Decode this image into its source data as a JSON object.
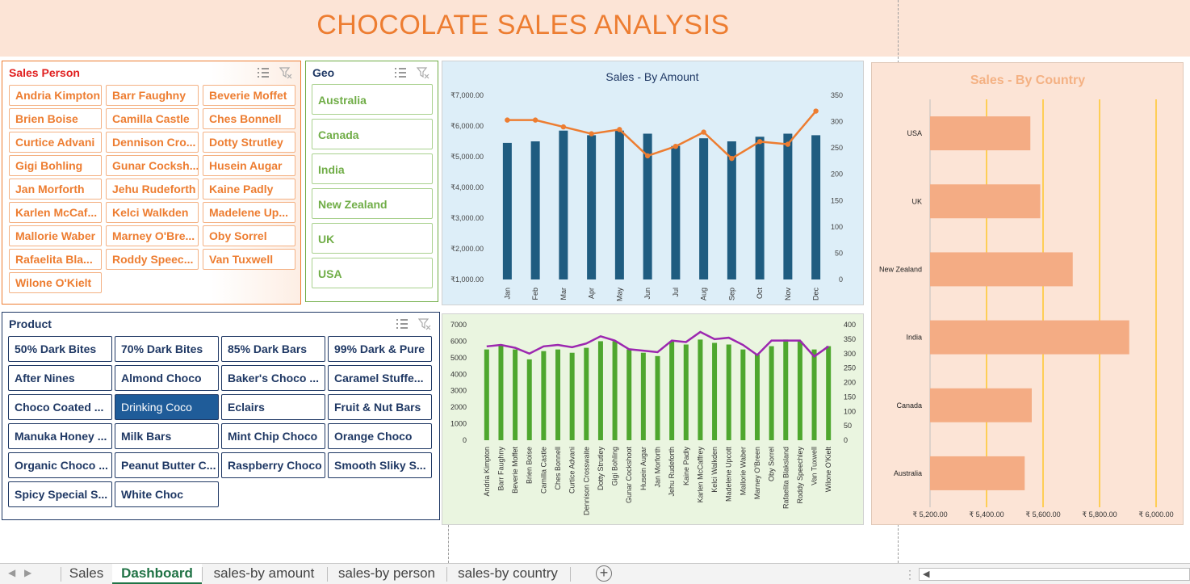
{
  "title": "CHOCOLATE SALES ANALYSIS",
  "colors": {
    "title": "#ed7d31",
    "title_bg": "#fce4d6",
    "sales_person": "#ed7d31",
    "geo": "#70ad47",
    "product": "#1f3864",
    "selected": "#1f5c99"
  },
  "sales_person_slicer": {
    "title": "Sales Person",
    "items": [
      "Andria Kimpton",
      "Barr Faughny",
      "Beverie Moffet",
      "Brien Boise",
      "Camilla Castle",
      "Ches Bonnell",
      "Curtice Advani",
      "Dennison Cro...",
      "Dotty Strutley",
      "Gigi Bohling",
      "Gunar Cocksh...",
      "Husein Augar",
      "Jan Morforth",
      "Jehu Rudeforth",
      "Kaine Padly",
      "Karlen McCaf...",
      "Kelci Walkden",
      "Madelene Up...",
      "Mallorie Waber",
      "Marney O'Bre...",
      "Oby Sorrel",
      "Rafaelita Bla...",
      "Roddy Speec...",
      "Van Tuxwell",
      "Wilone O'Kielt"
    ]
  },
  "geo_slicer": {
    "title": "Geo",
    "items": [
      "Australia",
      "Canada",
      "India",
      "New Zealand",
      "UK",
      "USA"
    ]
  },
  "product_slicer": {
    "title": "Product",
    "selected": "Drinking Coco",
    "items": [
      "50% Dark Bites",
      "70% Dark Bites",
      "85% Dark Bars",
      "99% Dark & Pure",
      "After Nines",
      "Almond Choco",
      "Baker's Choco ...",
      "Caramel Stuffe...",
      "Choco Coated ...",
      "Drinking Coco",
      "Eclairs",
      "Fruit & Nut Bars",
      "Manuka Honey ...",
      "Milk Bars",
      "Mint Chip Choco",
      "Orange Choco",
      "Organic Choco ...",
      "Peanut Butter C...",
      "Raspberry Choco",
      "Smooth Sliky S...",
      "Spicy Special S...",
      "White Choc"
    ]
  },
  "icons": {
    "multi_select": "multi-select-icon",
    "clear_filter": "clear-filter-icon"
  },
  "chart_data": [
    {
      "type": "bar",
      "title": "Sales - By Amount",
      "categories": [
        "Jan",
        "Feb",
        "Mar",
        "Apr",
        "May",
        "Jun",
        "Jul",
        "Aug",
        "Sep",
        "Oct",
        "Nov",
        "Dec"
      ],
      "bar_values": [
        5450,
        5500,
        5850,
        5700,
        5850,
        5750,
        5350,
        5600,
        5500,
        5650,
        5750,
        5700
      ],
      "line_values": [
        303,
        303,
        290,
        277,
        285,
        235,
        253,
        280,
        230,
        262,
        257,
        320
      ],
      "yticks_left": [
        "₹7,000.00",
        "₹6,000.00",
        "₹5,000.00",
        "₹4,000.00",
        "₹3,000.00",
        "₹2,000.00",
        "₹1,000.00"
      ],
      "yticks_right": [
        "350",
        "300",
        "250",
        "200",
        "150",
        "100",
        "50",
        "0"
      ],
      "ylim_left": [
        1000,
        7000
      ],
      "ylim_right": [
        0,
        350
      ],
      "bar_color": "#1f5c80",
      "line_color": "#ed7d31"
    },
    {
      "type": "bar",
      "categories": [
        "Andria Kimpton",
        "Barr Faughny",
        "Beverie Moffet",
        "Brien Boise",
        "Camilla Castle",
        "Ches Bonnell",
        "Curtice Advani",
        "Dennison Crosswaite",
        "Dotty Strutley",
        "Gigi Bohling",
        "Gunar Cockshoot",
        "Husein Augar",
        "Jan Morforth",
        "Jehu Rudeforth",
        "Kaine Padly",
        "Karlen McCaffrey",
        "Kelci Walkden",
        "Madelene Upcott",
        "Mallorie Waber",
        "Marney O'Breen",
        "Oby Sorrel",
        "Rafaelita Blaksland",
        "Roddy Speechley",
        "Van Tuxwell",
        "Wilone O'Kielt"
      ],
      "bar_values": [
        5500,
        5800,
        5500,
        4900,
        5400,
        5500,
        5300,
        5600,
        6000,
        6000,
        5500,
        5300,
        5100,
        6000,
        5800,
        6100,
        5900,
        5800,
        5500,
        5200,
        5700,
        6100,
        6000,
        5500,
        5700
      ],
      "line_values": [
        325,
        330,
        320,
        300,
        325,
        330,
        322,
        335,
        360,
        345,
        315,
        310,
        305,
        345,
        340,
        375,
        350,
        355,
        330,
        295,
        345,
        345,
        345,
        290,
        325
      ],
      "yticks_left": [
        "7000",
        "6000",
        "5000",
        "4000",
        "3000",
        "2000",
        "1000",
        "0"
      ],
      "yticks_right": [
        "400",
        "350",
        "300",
        "250",
        "200",
        "150",
        "100",
        "50",
        "0"
      ],
      "ylim_left": [
        0,
        7000
      ],
      "ylim_right": [
        0,
        400
      ],
      "bar_color": "#4ea72e",
      "line_color": "#9c27b0"
    },
    {
      "type": "bar",
      "title": "Sales - By Country",
      "categories": [
        "USA",
        "UK",
        "New Zealand",
        "India",
        "Canada",
        "Australia"
      ],
      "values": [
        5555,
        5590,
        5705,
        5905,
        5560,
        5535
      ],
      "xticks": [
        "₹ 5,200.00",
        "₹ 5,400.00",
        "₹ 5,600.00",
        "₹ 5,800.00",
        "₹ 6,000.00"
      ],
      "xlim": [
        5200,
        6000
      ],
      "bar_color": "#f4ac84"
    }
  ],
  "tabs": {
    "sales": "Sales",
    "dashboard": "Dashboard",
    "by_amount": "sales-by amount",
    "by_person": "sales-by person",
    "by_country": "sales-by country",
    "add": "+"
  }
}
